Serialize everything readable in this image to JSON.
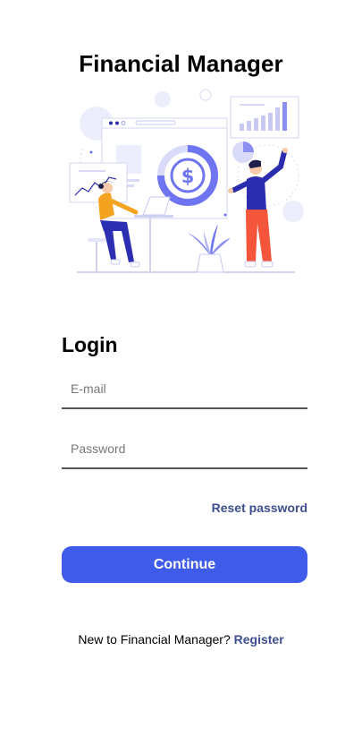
{
  "app": {
    "title": "Financial Manager"
  },
  "illustration": {
    "icon": "finance-dashboard-illustration",
    "symbol": "$",
    "colors": {
      "primary": "#6f75f0",
      "accent": "#3f5bea",
      "person_shirt": "#f4a321",
      "person_pants": "#2c2fb2",
      "man_shirt": "#2b2dae",
      "man_pants": "#f4553b",
      "plant": "#8c8ff2"
    }
  },
  "login": {
    "heading": "Login",
    "email_placeholder": "E-mail",
    "email_value": "",
    "password_placeholder": "Password",
    "password_value": "",
    "reset_password_label": "Reset password",
    "continue_label": "Continue",
    "continue_color": "#3f5bea",
    "link_color": "#3d4f8f"
  },
  "register": {
    "prompt": "New to Financial Manager?",
    "link_label": "Register"
  }
}
